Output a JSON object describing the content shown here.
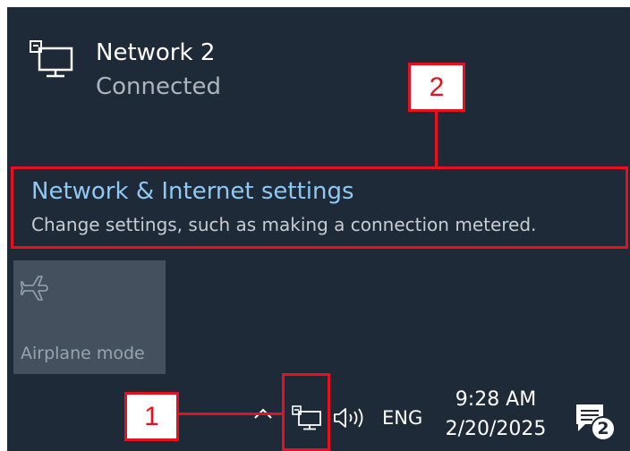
{
  "network": {
    "name": "Network 2",
    "status": "Connected",
    "icon": "ethernet-network-icon"
  },
  "settings_link": {
    "title": "Network & Internet settings",
    "description": "Change settings, such as making a connection metered."
  },
  "quick_actions": [
    {
      "label": "Airplane mode",
      "icon": "airplane-icon",
      "enabled": false
    }
  ],
  "taskbar": {
    "chevron_icon": "chevron-up-icon",
    "network_icon": "ethernet-network-icon",
    "volume_icon": "speaker-volume-icon",
    "language": "ENG",
    "time": "9:28 AM",
    "date": "2/20/2025",
    "notification_icon": "action-center-icon",
    "notification_count": "2"
  },
  "annotations": [
    {
      "label": "1",
      "target": "taskbar-network-icon"
    },
    {
      "label": "2",
      "target": "network-internet-settings-link"
    }
  ],
  "colors": {
    "background": "#1f2a38",
    "link": "#8fc9f2",
    "annotation": "#e8101e",
    "tile": "#44505e"
  }
}
